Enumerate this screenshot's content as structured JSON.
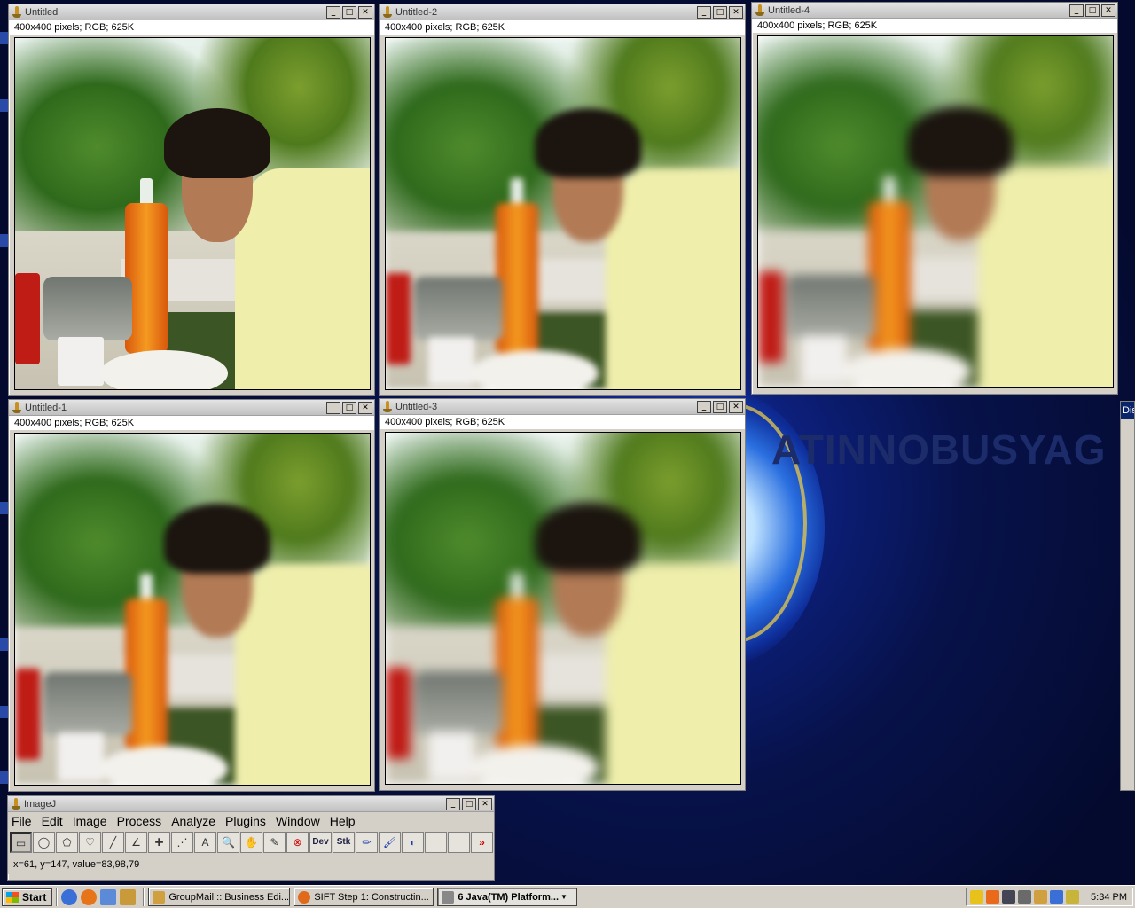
{
  "windows": [
    {
      "title": "Untitled",
      "info": "400x400 pixels; RGB; 625K"
    },
    {
      "title": "Untitled-2",
      "info": "400x400 pixels; RGB; 625K"
    },
    {
      "title": "Untitled-4",
      "info": "400x400 pixels; RGB; 625K"
    },
    {
      "title": "Untitled-1",
      "info": "400x400 pixels; RGB; 625K"
    },
    {
      "title": "Untitled-3",
      "info": "400x400 pixels; RGB; 625K"
    }
  ],
  "window_buttons": {
    "minimize": "_",
    "maximize": "□",
    "close": "✕"
  },
  "imagej": {
    "title": "ImageJ",
    "menus": [
      "File",
      "Edit",
      "Image",
      "Process",
      "Analyze",
      "Plugins",
      "Window",
      "Help"
    ],
    "tools": [
      {
        "label": "▭",
        "icon": "rectangle-icon"
      },
      {
        "label": "◯",
        "icon": "oval-icon"
      },
      {
        "label": "⬠",
        "icon": "polygon-icon"
      },
      {
        "label": "♡",
        "icon": "freehand-icon"
      },
      {
        "label": "╱",
        "icon": "line-icon"
      },
      {
        "label": "∠",
        "icon": "angle-icon"
      },
      {
        "label": "✚",
        "icon": "point-icon"
      },
      {
        "label": "⋰",
        "icon": "wand-icon"
      },
      {
        "label": "A",
        "icon": "text-icon"
      },
      {
        "label": "🔍",
        "icon": "magnifier-icon"
      },
      {
        "label": "✋",
        "icon": "hand-icon"
      },
      {
        "label": "✎",
        "icon": "dropper-icon"
      },
      {
        "label": "⊗",
        "icon": "custom-tool-icon"
      },
      {
        "label": "Dev",
        "icon": "dev-menu-icon"
      },
      {
        "label": "Stk",
        "icon": "stack-menu-icon"
      },
      {
        "label": "✏",
        "icon": "pencil-icon"
      },
      {
        "label": "🖌",
        "icon": "brush-icon"
      },
      {
        "label": "◐",
        "icon": "flood-fill-icon"
      },
      {
        "label": "",
        "icon": "empty-slot"
      },
      {
        "label": "",
        "icon": "empty-slot"
      },
      {
        "label": "»",
        "icon": "more-tools-icon"
      }
    ],
    "status": "x=61, y=147, value=83,98,79"
  },
  "side_window_title": "Dis",
  "taskbar": {
    "start": "Start",
    "tasks": [
      {
        "label": "GroupMail :: Business Edi...",
        "color": "#d0a040"
      },
      {
        "label": "SIFT Step 1: Constructin...",
        "color": "#e06a1a"
      },
      {
        "label": "6 Java(TM) Platform...",
        "color": "#888888"
      }
    ],
    "clock": "5:34 PM"
  },
  "desktop_logo_text": "ATINNOBUSYAG"
}
